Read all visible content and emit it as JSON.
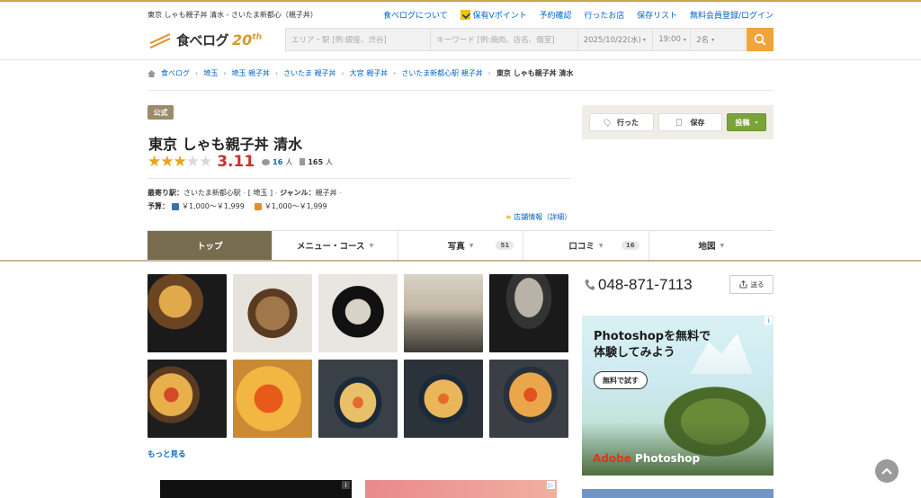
{
  "header": {
    "site_title": "東京 しゃも親子丼 清水 - さいたま新都心（親子丼）",
    "links": [
      "食べログについて",
      "保有Vポイント",
      "予約確認",
      "行ったお店",
      "保存リスト",
      "無料会員登録/ログイン"
    ],
    "logo_text": "食べログ",
    "logo_anniv": "20",
    "logo_anniv_sup": "th"
  },
  "search": {
    "area_placeholder": "エリア・駅 [例:銀座、渋谷]",
    "keyword_placeholder": "キーワード [例:焼肉、店名、個室]",
    "date": "2025/10/22(水)",
    "time": "19:00",
    "people": "2名"
  },
  "breadcrumb": [
    "食べログ",
    "埼玉",
    "埼玉 親子丼",
    "さいたま 親子丼",
    "大宮 親子丼",
    "さいたま新都心駅 親子丼",
    "東京 しゃも親子丼 清水"
  ],
  "shop": {
    "badge": "公式",
    "name": "東京 しゃも親子丼 清水",
    "score": "3.11",
    "stars_on": 3,
    "reviews": "16",
    "reviews_unit": "人",
    "saves": "165",
    "saves_unit": "人",
    "station_label": "最寄り駅：",
    "station": "さいたま新都心駅",
    "area_label": "[ 埼玉 ]",
    "genre_label": "ジャンル：",
    "genre": "親子丼",
    "budget_label": "予算：",
    "budget_dinner": "￥1,000～￥1,999",
    "budget_lunch": "￥1,000～￥1,999",
    "info_link": "店舗情報（詳細）"
  },
  "actions": {
    "went": "行った",
    "save": "保存",
    "post": "投稿"
  },
  "tabs": [
    {
      "label": "トップ",
      "count": ""
    },
    {
      "label": "メニュー・コース",
      "count": ""
    },
    {
      "label": "写真",
      "count": "51"
    },
    {
      "label": "口コミ",
      "count": "16"
    },
    {
      "label": "地図",
      "count": ""
    }
  ],
  "photos": {
    "more": "もっと見る"
  },
  "contact": {
    "phone": "048-871-7113",
    "share": "送る"
  },
  "ad": {
    "title_line1": "Photoshopを無料で",
    "title_line2": "体験してみよう",
    "button": "無料で試す",
    "brand_adobe": "Adobe",
    "brand_product": " Photoshop"
  }
}
